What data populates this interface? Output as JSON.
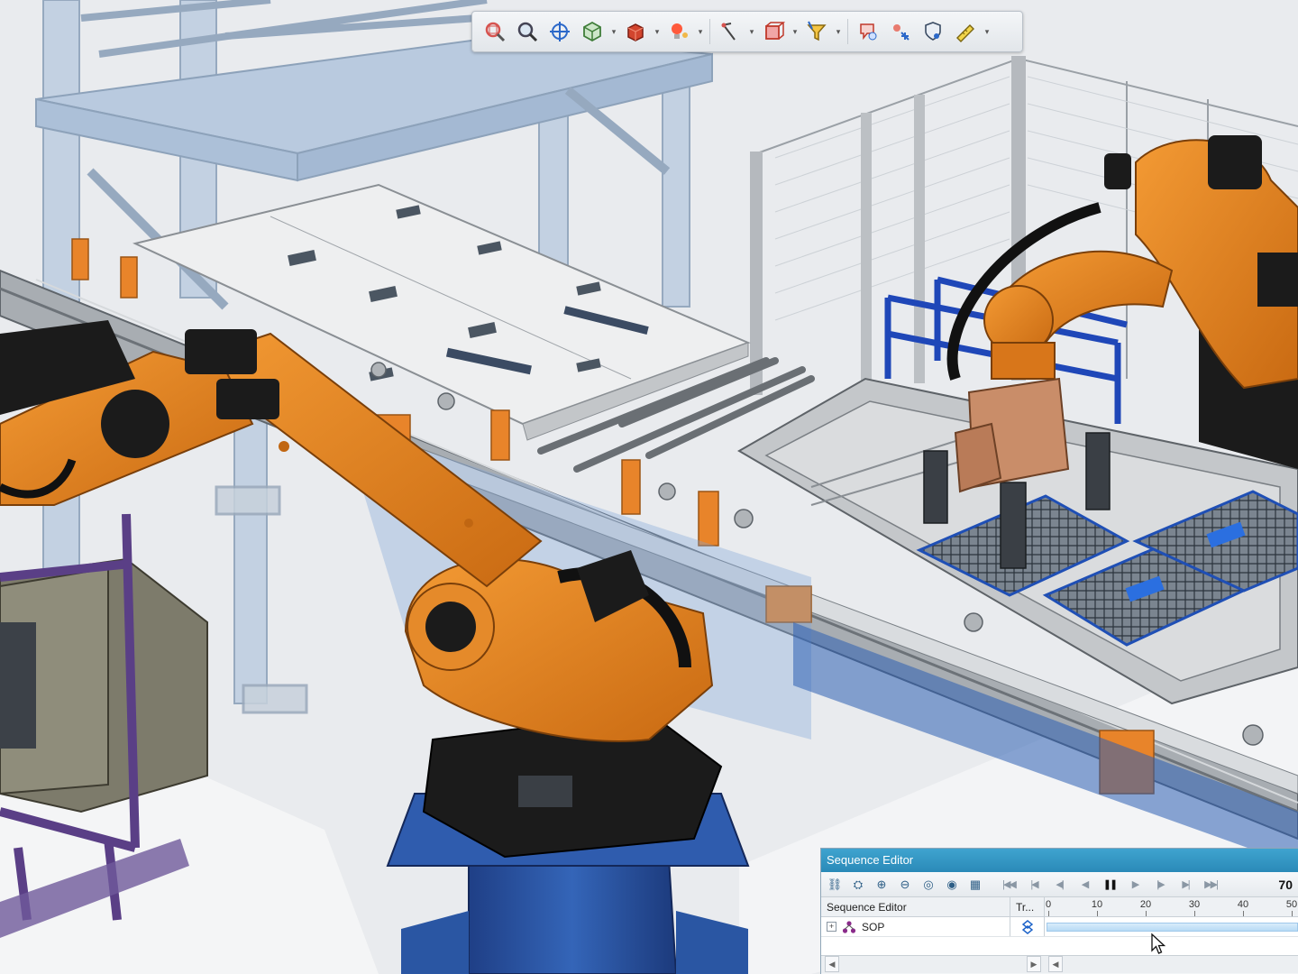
{
  "viewport": {
    "scene": "robotic-cell-3d",
    "colors": {
      "robot_orange": "#e8841f",
      "robot_black": "#1b1b1b",
      "pedestal_blue": "#2a56a3",
      "frame_blue": "#1f47b8",
      "fence_gray": "#c9ccd0",
      "floor": "#e9ebee",
      "glass_blue": "#9fb9d6",
      "fixture_purple": "#5a3f86",
      "tray_gray": "#b9bcbf"
    }
  },
  "toolbar": {
    "buttons": [
      {
        "icon": "zoom-window-icon"
      },
      {
        "icon": "zoom-fit-icon"
      },
      {
        "icon": "pan-target-icon"
      },
      {
        "icon": "view-cube-icon",
        "has_menu": true
      },
      {
        "icon": "solid-box-icon",
        "has_menu": true
      },
      {
        "icon": "light-bulb-icon",
        "has_menu": true
      },
      {
        "icon": "measure-icon",
        "has_menu": true
      },
      {
        "icon": "section-box-icon",
        "has_menu": true
      },
      {
        "icon": "select-filter-icon",
        "has_menu": true
      },
      {
        "icon": "placement-icon"
      },
      {
        "icon": "relocate-icon"
      },
      {
        "icon": "shield-tag-icon"
      },
      {
        "icon": "ruler-pen-icon",
        "has_menu": true
      }
    ]
  },
  "sequence_editor": {
    "title": "Sequence Editor",
    "current_frame": "70",
    "tools": [
      "link-icon",
      "link-scan-icon",
      "zoom-in-icon",
      "zoom-out-icon",
      "zoom-fit-icon",
      "zoom-selection-icon",
      "layout-icon"
    ],
    "playback": [
      "go-start-icon",
      "step-back-icon",
      "play-back-icon",
      "reverse-icon",
      "pause-icon",
      "play-icon",
      "step-forward-icon",
      "next-icon",
      "go-end-icon"
    ],
    "columns": {
      "name": "Sequence Editor",
      "transition": "Tr..."
    },
    "ruler": [
      {
        "label": "0",
        "value": 0
      },
      {
        "label": "10",
        "value": 10
      },
      {
        "label": "20",
        "value": 20
      },
      {
        "label": "30",
        "value": 30
      },
      {
        "label": "40",
        "value": 40
      },
      {
        "label": "50",
        "value": 50
      }
    ],
    "rows": [
      {
        "name": "SOP",
        "expander": "+",
        "transition_icon": "transition-icon"
      }
    ]
  }
}
